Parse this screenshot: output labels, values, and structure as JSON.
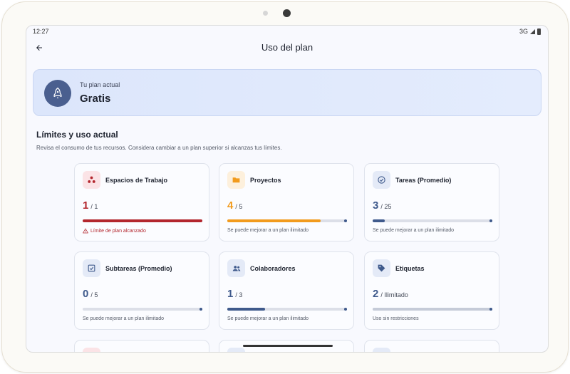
{
  "status_bar": {
    "time": "12:27",
    "network": "3G"
  },
  "app_bar": {
    "title": "Uso del plan",
    "back_icon": "arrow-left-icon"
  },
  "plan": {
    "label": "Tu plan actual",
    "name": "Gratis",
    "icon": "rocket-icon"
  },
  "section": {
    "title": "Límites y uso actual",
    "description": "Revisa el consumo de tus recursos. Considera cambiar a un plan superior si alcanzas tus límites."
  },
  "cards": [
    {
      "title": "Espacios de Trabajo",
      "icon": "workspaces-icon",
      "value": "1",
      "limit": "/ 1",
      "fill": 1.0,
      "note": "Límite de plan alcanzado",
      "color": "#b3262d",
      "icon_bg": "#fbe3e6"
    },
    {
      "title": "Proyectos",
      "icon": "folder-icon",
      "value": "4",
      "limit": "/ 5",
      "fill": 0.8,
      "note": "Se puede mejorar a un plan ilimitado",
      "color": "#f29b1d",
      "icon_bg": "#fdf0dc"
    },
    {
      "title": "Tareas (Promedio)",
      "icon": "check-circle-icon",
      "value": "3",
      "limit": "/ 25",
      "fill": 0.12,
      "note": "Se puede mejorar a un plan ilimitado",
      "color": "#3f5a8c",
      "icon_bg": "#e4eaf7"
    },
    {
      "title": "Subtareas (Promedio)",
      "icon": "checkbox-icon",
      "value": "0",
      "limit": "/ 5",
      "fill": 0.0,
      "note": "Se puede mejorar a un plan ilimitado",
      "color": "#3f5a8c",
      "icon_bg": "#e4eaf7"
    },
    {
      "title": "Colaboradores",
      "icon": "people-icon",
      "value": "1",
      "limit": "/ 3",
      "fill": 0.333,
      "note": "Se puede mejorar a un plan ilimitado",
      "color": "#3f5a8c",
      "icon_bg": "#e4eaf7"
    },
    {
      "title": "Etiquetas",
      "icon": "tag-icon",
      "value": "2",
      "limit": "/ Ilimitado",
      "fill": 1.0,
      "note": "Uso sin restricciones",
      "color": "#3f5a8c",
      "icon_bg": "#e4eaf7"
    }
  ],
  "colors": {
    "accent": "#4a5f8f",
    "danger": "#b3262d",
    "warning": "#f29b1d",
    "neutral_fill": "#c5cbd8"
  }
}
